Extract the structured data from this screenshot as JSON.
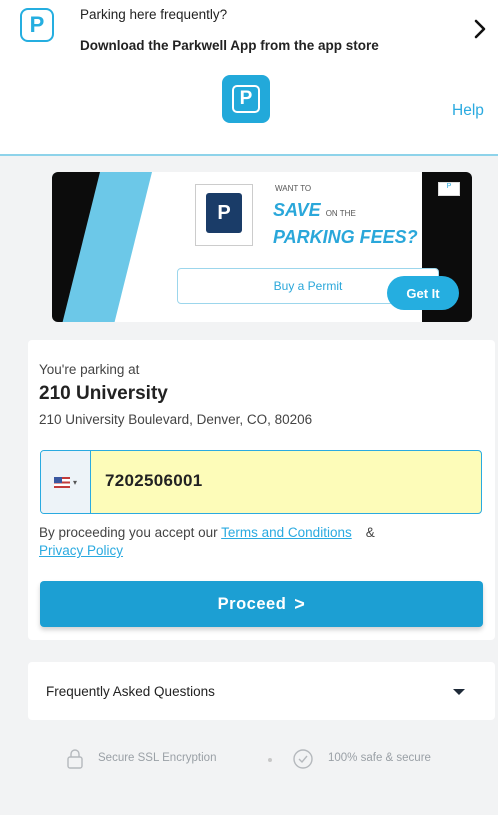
{
  "banner": {
    "logo_letter": "P",
    "line1": "Parking here frequently?",
    "line2": "Download the Parkwell App from the app store",
    "chevron_icon": "chevron-right-icon"
  },
  "header": {
    "logo_letter": "P",
    "help_label": "Help"
  },
  "ad": {
    "sign_letter": "P",
    "want_to": "WANT TO",
    "save": "SAVE",
    "on_the": "ON THE",
    "parking_fees": "PARKING FEES?",
    "buy_permit": "Buy a Permit",
    "get_it": "Get It"
  },
  "parking": {
    "label": "You're parking at",
    "location_name": "210 University",
    "address": "210 University Boulevard, Denver, CO, 80206"
  },
  "phone": {
    "country_flag": "us-flag-icon",
    "value": "7202506001"
  },
  "consent": {
    "prefix": "By proceeding you accept our",
    "terms_link": "Terms and Conditions",
    "ampersand": "&",
    "privacy_link": "Privacy Policy"
  },
  "proceed": {
    "label": "Proceed",
    "chevron": ">"
  },
  "faq": {
    "label": "Frequently Asked Questions"
  },
  "security": {
    "ssl_text": "Secure SSL Encryption",
    "safe_text": "100% safe & secure"
  },
  "colors": {
    "accent": "#25aee0",
    "proceed_button": "#1c9fd3",
    "phone_field_bg": "#fdfcb9",
    "ad_background": "#0c0c0c",
    "page_background": "#f2f3f4"
  }
}
